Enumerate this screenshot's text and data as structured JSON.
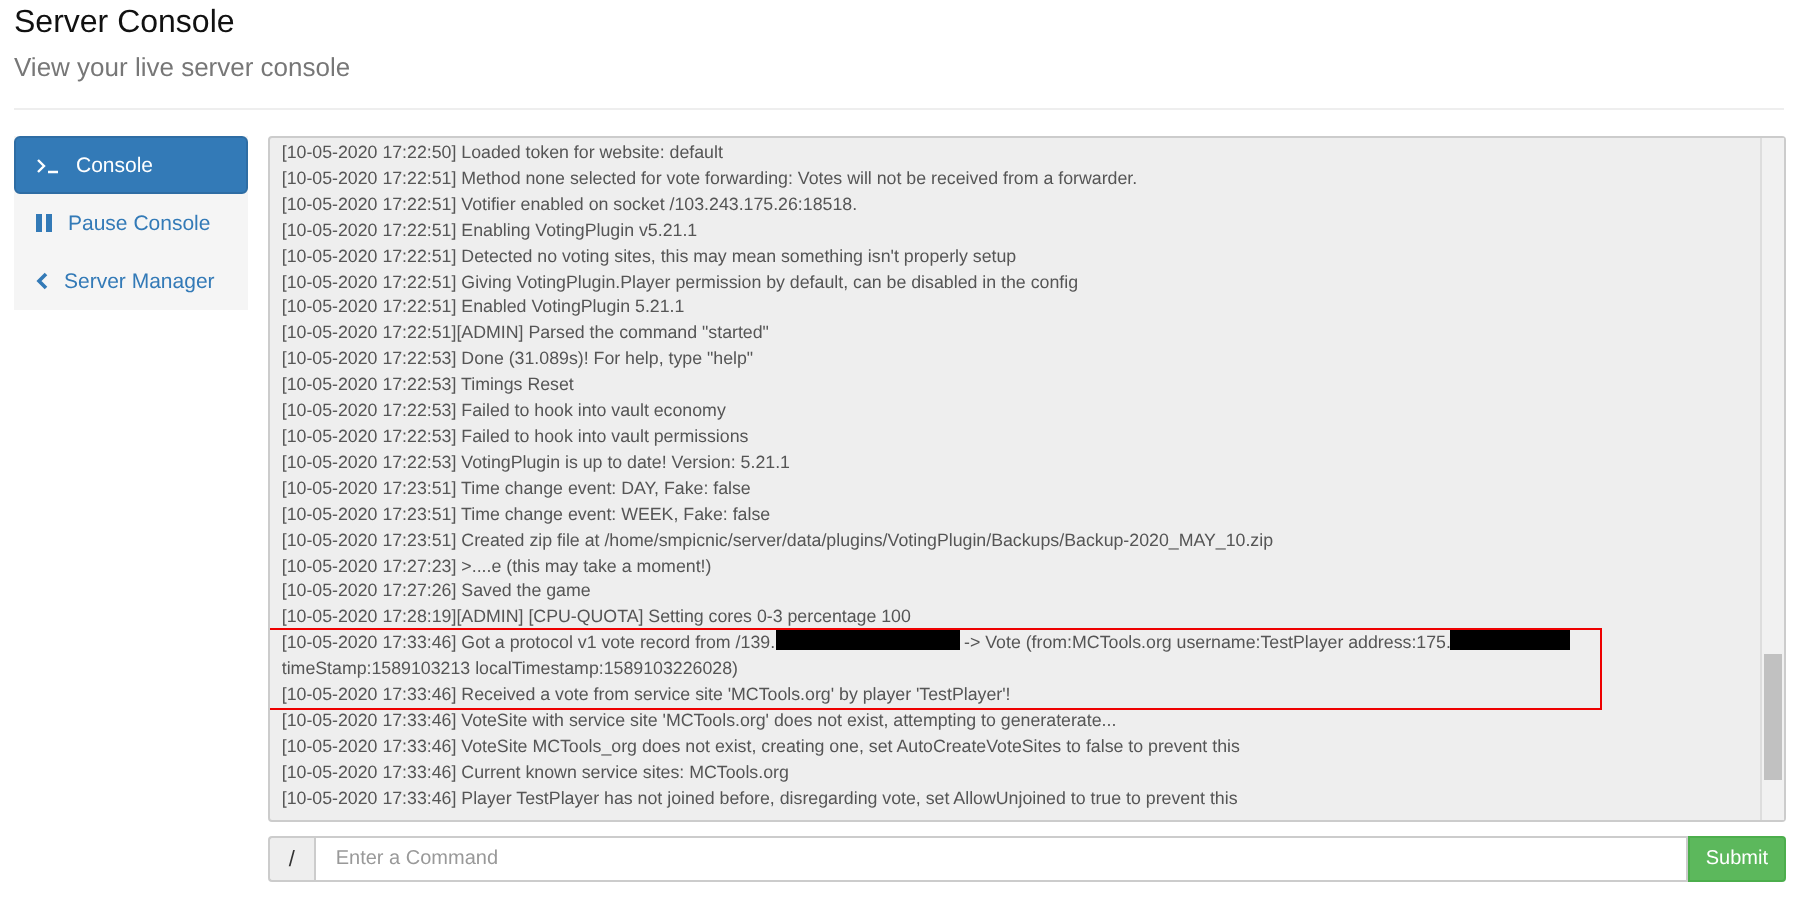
{
  "header": {
    "title": "Server Console",
    "subtitle": "View your live server console"
  },
  "sidebar": {
    "items": [
      {
        "kind": "terminal",
        "label": "Console",
        "selected": true
      },
      {
        "kind": "pause",
        "label": "Pause Console",
        "selected": false
      },
      {
        "kind": "back",
        "label": "Server Manager",
        "selected": false
      }
    ]
  },
  "console": {
    "sections": [
      {
        "highlighted": false,
        "lines": [
          {
            "parts": [
              {
                "kind": "text",
                "text": "[10-05-2020 17:22:50] Loaded token for website: default"
              }
            ]
          },
          {
            "parts": [
              {
                "kind": "text",
                "text": "[10-05-2020 17:22:51] Method none selected for vote forwarding: Votes will not be received from a forwarder."
              }
            ]
          },
          {
            "parts": [
              {
                "kind": "text",
                "text": "[10-05-2020 17:22:51] Votifier enabled on socket /103.243.175.26:18518."
              }
            ]
          },
          {
            "parts": [
              {
                "kind": "text",
                "text": "[10-05-2020 17:22:51] Enabling VotingPlugin v5.21.1"
              }
            ]
          },
          {
            "parts": [
              {
                "kind": "text",
                "text": "[10-05-2020 17:22:51] Detected no voting sites, this may mean something isn't properly setup"
              }
            ]
          },
          {
            "parts": [
              {
                "kind": "text",
                "text": "[10-05-2020 17:22:51] Giving VotingPlugin.Player permission by default, can be disabled in the config"
              }
            ]
          },
          {
            "parts": [
              {
                "kind": "text",
                "text": "[10-05-2020 17:22:51] Enabled VotingPlugin 5.21.1"
              }
            ]
          },
          {
            "parts": [
              {
                "kind": "text",
                "text": "[10-05-2020 17:22:51][ADMIN] Parsed the command \"started\""
              }
            ]
          },
          {
            "parts": [
              {
                "kind": "text",
                "text": "[10-05-2020 17:22:53] Done (31.089s)! For help, type \"help\""
              }
            ]
          },
          {
            "parts": [
              {
                "kind": "text",
                "text": "[10-05-2020 17:22:53] Timings Reset"
              }
            ]
          },
          {
            "parts": [
              {
                "kind": "text",
                "text": "[10-05-2020 17:22:53] Failed to hook into vault economy"
              }
            ]
          },
          {
            "parts": [
              {
                "kind": "text",
                "text": "[10-05-2020 17:22:53] Failed to hook into vault permissions"
              }
            ]
          },
          {
            "parts": [
              {
                "kind": "text",
                "text": "[10-05-2020 17:22:53] VotingPlugin is up to date! Version: 5.21.1"
              }
            ]
          },
          {
            "parts": [
              {
                "kind": "text",
                "text": "[10-05-2020 17:23:51] Time change event: DAY, Fake: false"
              }
            ]
          },
          {
            "parts": [
              {
                "kind": "text",
                "text": "[10-05-2020 17:23:51] Time change event: WEEK, Fake: false"
              }
            ]
          },
          {
            "parts": [
              {
                "kind": "text",
                "text": "[10-05-2020 17:23:51] Created zip file at /home/smpicnic/server/data/plugins/VotingPlugin/Backups/Backup-2020_MAY_10.zip"
              }
            ]
          },
          {
            "parts": [
              {
                "kind": "text",
                "text": "[10-05-2020 17:27:23] >....e (this may take a moment!)"
              }
            ]
          },
          {
            "parts": [
              {
                "kind": "text",
                "text": "[10-05-2020 17:27:26] Saved the game"
              }
            ]
          },
          {
            "parts": [
              {
                "kind": "text",
                "text": "[10-05-2020 17:28:19][ADMIN] [CPU-QUOTA] Setting cores 0-3 percentage 100"
              }
            ]
          }
        ]
      },
      {
        "highlighted": true,
        "lines": [
          {
            "parts": [
              {
                "kind": "text",
                "text": "[10-05-2020 17:33:46] Got a protocol v1 vote record from /139."
              },
              {
                "kind": "redacted"
              },
              {
                "kind": "text",
                "text": " -> Vote (from:MCTools.org username:TestPlayer address:175."
              },
              {
                "kind": "redacted"
              },
              {
                "kind": "break"
              },
              {
                "kind": "text",
                "text": "timeStamp:1589103213 localTimestamp:1589103226028)"
              }
            ]
          },
          {
            "parts": [
              {
                "kind": "text",
                "text": "[10-05-2020 17:33:46] Received a vote from service site 'MCTools.org' by player 'TestPlayer'!"
              }
            ]
          }
        ]
      },
      {
        "highlighted": false,
        "lines": [
          {
            "parts": [
              {
                "kind": "text",
                "text": "[10-05-2020 17:33:46] VoteSite with service site 'MCTools.org' does not exist, attempting to generaterate..."
              }
            ]
          },
          {
            "parts": [
              {
                "kind": "text",
                "text": "[10-05-2020 17:33:46] VoteSite MCTools_org does not exist, creating one, set AutoCreateVoteSites to false to prevent this"
              }
            ]
          },
          {
            "parts": [
              {
                "kind": "text",
                "text": "[10-05-2020 17:33:46] Current known service sites: MCTools.org"
              }
            ]
          },
          {
            "parts": [
              {
                "kind": "text",
                "text": "[10-05-2020 17:33:46] Player TestPlayer has not joined before, disregarding vote, set AllowUnjoined to true to prevent this"
              }
            ]
          }
        ]
      }
    ]
  },
  "command": {
    "prefix": "/",
    "placeholder": "Enter a Command",
    "submit": "Submit"
  }
}
